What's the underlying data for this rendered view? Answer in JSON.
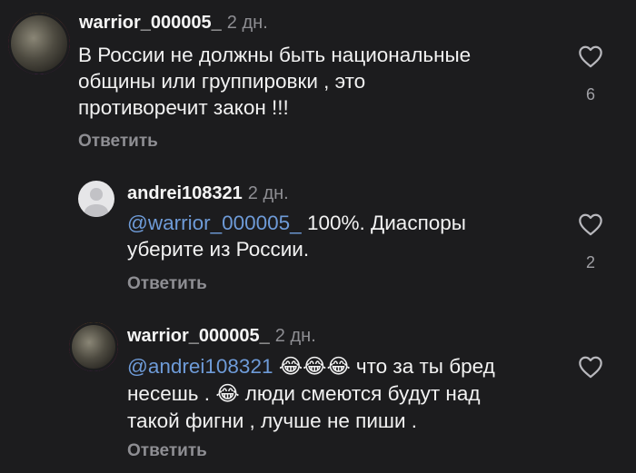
{
  "comments": [
    {
      "username": "warrior_000005_",
      "time": "2 дн.",
      "line1": "В России не должны быть национальные",
      "line2": "общины или группировки , это",
      "line3": "противоречит закон !!!",
      "likes": "6",
      "reply_label": "Ответить"
    },
    {
      "username": "andrei108321",
      "time": "2 дн.",
      "mention": "@warrior_000005_",
      "line1_rest": " 100%. Диаспоры",
      "line2": "уберите из России.",
      "likes": "2",
      "reply_label": "Ответить"
    },
    {
      "username": "warrior_000005_",
      "time": "2 дн.",
      "mention": "@andrei108321",
      "emoji1": "😂😂😂",
      "line1_rest": "  что за ты бред",
      "line2_start": "несешь . ",
      "emoji2": "😂",
      "line2_rest": " люди смеются будут над",
      "line3": "такой фигни , лучше не пиши .",
      "reply_label": "Ответить"
    }
  ],
  "icons": {
    "like": "heart-outline-icon"
  }
}
